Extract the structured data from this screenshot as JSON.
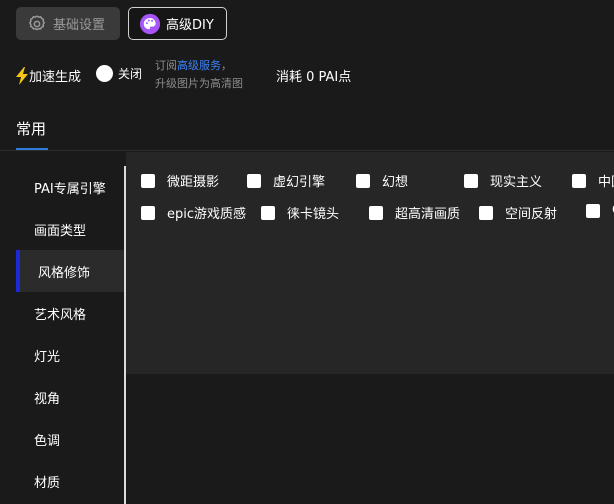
{
  "header": {
    "basic_settings_label": "基础设置",
    "advanced_diy_label": "高级DIY"
  },
  "options_bar": {
    "speed_label": "加速生成",
    "toggle_state_label": "关闭",
    "subscribe_prefix": "订阅",
    "subscribe_link": "高级服务",
    "subscribe_suffix": "，",
    "upgrade_text": "升级图片为高清图",
    "cost_text": "消耗 0 PAI点"
  },
  "tabs": {
    "common_label": "常用"
  },
  "sidebar": {
    "items": [
      {
        "label": "PAI专属引擎"
      },
      {
        "label": "画面类型"
      },
      {
        "label": "风格修饰"
      },
      {
        "label": "艺术风格"
      },
      {
        "label": "灯光"
      },
      {
        "label": "视角"
      },
      {
        "label": "色调"
      },
      {
        "label": "材质"
      }
    ],
    "active_index": 2
  },
  "style_options": {
    "row1": [
      "微距摄影",
      "虚幻引擎",
      "幻想",
      "现实主义",
      "中国风"
    ],
    "row2": [
      "epic游戏质感",
      "徕卡镜头",
      "超高清画质",
      "空间反射",
      "CG"
    ]
  },
  "colors": {
    "accent_blue": "#2f7bd8",
    "active_bar": "#1d2ad8",
    "link_blue": "#3b82f6",
    "bolt_yellow": "#f5c518",
    "palette_purple": "#a855f7"
  }
}
